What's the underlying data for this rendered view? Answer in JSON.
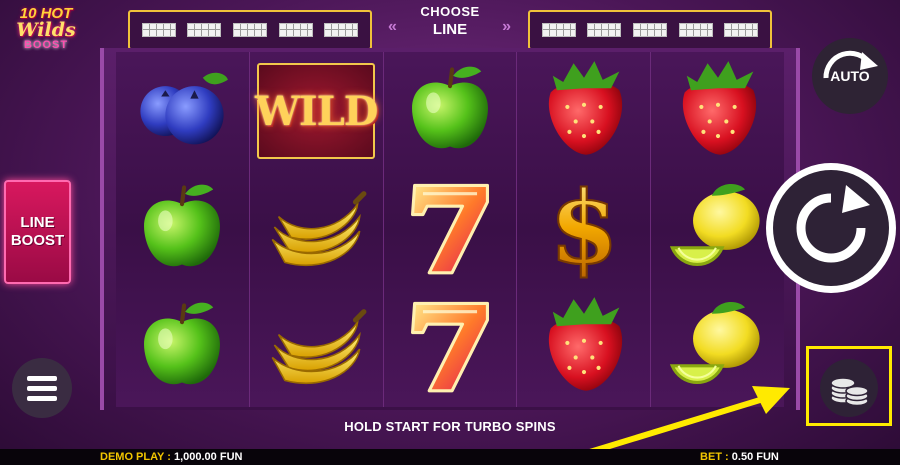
{
  "logo": {
    "line1": "10 HOT",
    "line2": "Wilds",
    "line3": "BOOST"
  },
  "line_selector": {
    "title": "CHOOSE",
    "value": "LINE",
    "prev_arrow": "«",
    "next_arrow": "»",
    "left_patterns": 5,
    "right_patterns": 5
  },
  "reels": [
    [
      "blueberry-icon",
      "apple-icon",
      "apple-icon"
    ],
    [
      "wild-symbol",
      "banana-icon",
      "banana-icon"
    ],
    [
      "apple-icon",
      "seven-icon",
      "seven-icon"
    ],
    [
      "strawberry-icon",
      "dollar-icon",
      "strawberry-icon"
    ],
    [
      "strawberry-icon",
      "lemon-icon",
      "lemon-icon"
    ]
  ],
  "wild_label": "WILD",
  "line_boost": {
    "line1": "LINE",
    "line2": "BOOST"
  },
  "auto_label": "AUTO",
  "turbo_message": "HOLD START FOR TURBO SPINS",
  "footer": {
    "demo_label": "DEMO PLAY :",
    "demo_value": "1,000.00 FUN",
    "bet_label": "BET :",
    "bet_value": "0.50 FUN"
  },
  "colors": {
    "accent_gold": "#f0c23a",
    "highlight_yellow": "#ffea00",
    "line_boost_pink": "#d8185e",
    "footer_label": "#f2c600"
  }
}
